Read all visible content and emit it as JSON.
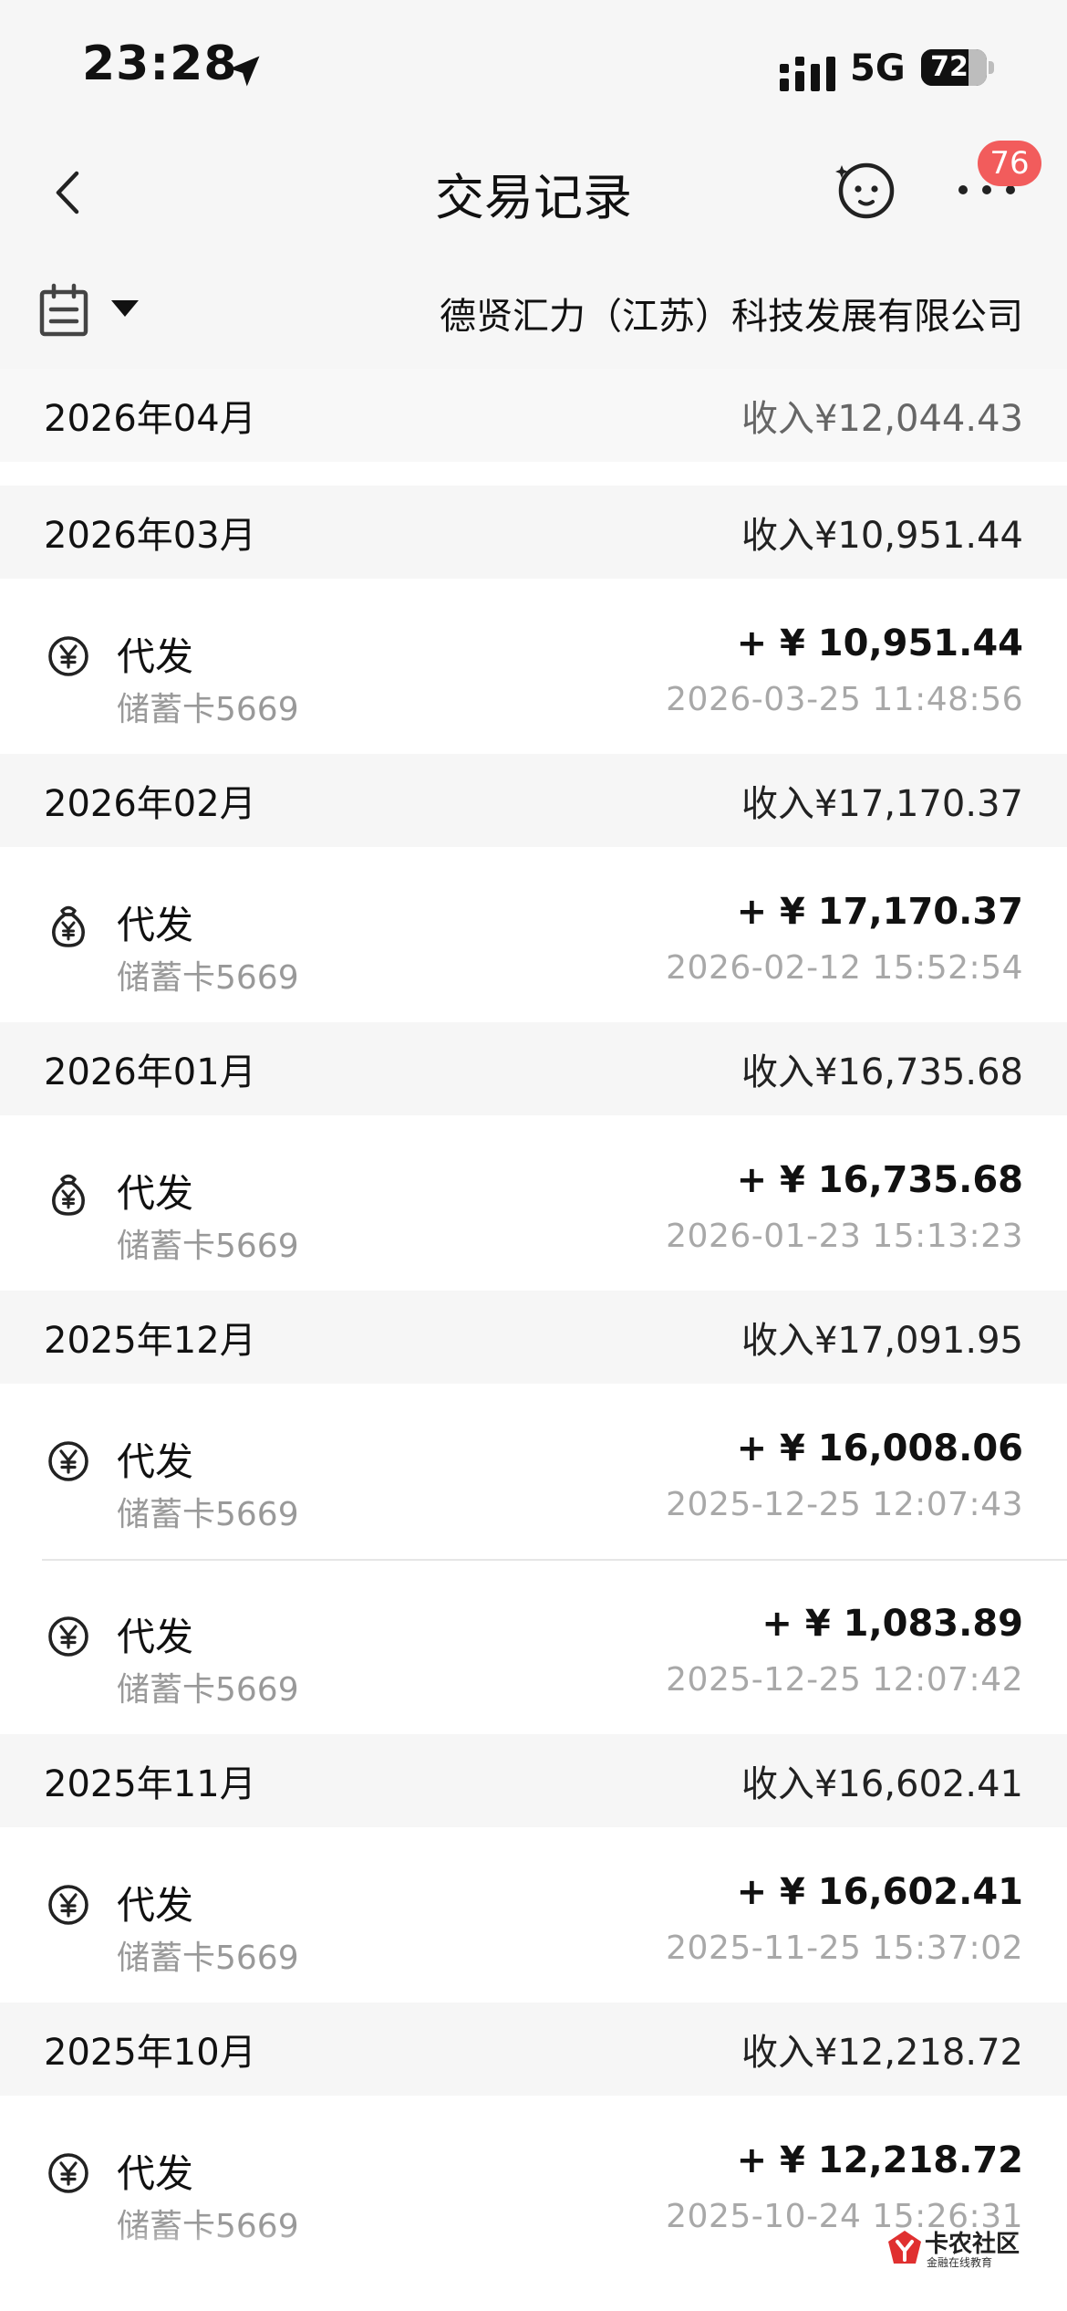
{
  "status_bar": {
    "time": "23:28",
    "network": "5G",
    "battery": "72",
    "battery_level": 0.72
  },
  "nav": {
    "title": "交易记录",
    "badge": "76"
  },
  "filter": {
    "company": "德贤汇力（江苏）科技发展有限公司"
  },
  "months": [
    {
      "label": "2026年04月",
      "total": "收入¥12,044.43",
      "transactions": []
    },
    {
      "label": "2026年03月",
      "total": "收入¥10,951.44",
      "transactions": [
        {
          "icon": "yen-coin-icon",
          "title": "代发",
          "card": "储蓄卡5669",
          "amount": "+ ¥ 10,951.44",
          "time": "2026-03-25 11:48:56"
        }
      ]
    },
    {
      "label": "2026年02月",
      "total": "收入¥17,170.37",
      "transactions": [
        {
          "icon": "money-bag-icon",
          "title": "代发",
          "card": "储蓄卡5669",
          "amount": "+ ¥ 17,170.37",
          "time": "2026-02-12 15:52:54"
        }
      ]
    },
    {
      "label": "2026年01月",
      "total": "收入¥16,735.68",
      "transactions": [
        {
          "icon": "money-bag-icon",
          "title": "代发",
          "card": "储蓄卡5669",
          "amount": "+ ¥ 16,735.68",
          "time": "2026-01-23 15:13:23"
        }
      ]
    },
    {
      "label": "2025年12月",
      "total": "收入¥17,091.95",
      "transactions": [
        {
          "icon": "yen-coin-icon",
          "title": "代发",
          "card": "储蓄卡5669",
          "amount": "+ ¥ 16,008.06",
          "time": "2025-12-25 12:07:43"
        },
        {
          "icon": "yen-coin-icon",
          "title": "代发",
          "card": "储蓄卡5669",
          "amount": "+ ¥ 1,083.89",
          "time": "2025-12-25 12:07:42"
        }
      ]
    },
    {
      "label": "2025年11月",
      "total": "收入¥16,602.41",
      "transactions": [
        {
          "icon": "yen-coin-icon",
          "title": "代发",
          "card": "储蓄卡5669",
          "amount": "+ ¥ 16,602.41",
          "time": "2025-11-25 15:37:02"
        }
      ]
    },
    {
      "label": "2025年10月",
      "total": "收入¥12,218.72",
      "transactions": [
        {
          "icon": "yen-coin-icon",
          "title": "代发",
          "card": "储蓄卡5669",
          "amount": "+ ¥ 12,218.72",
          "time": "2025-10-24 15:26:31"
        }
      ]
    }
  ],
  "watermark": {
    "name": "卡农社区",
    "tagline": "金融在线教育"
  }
}
